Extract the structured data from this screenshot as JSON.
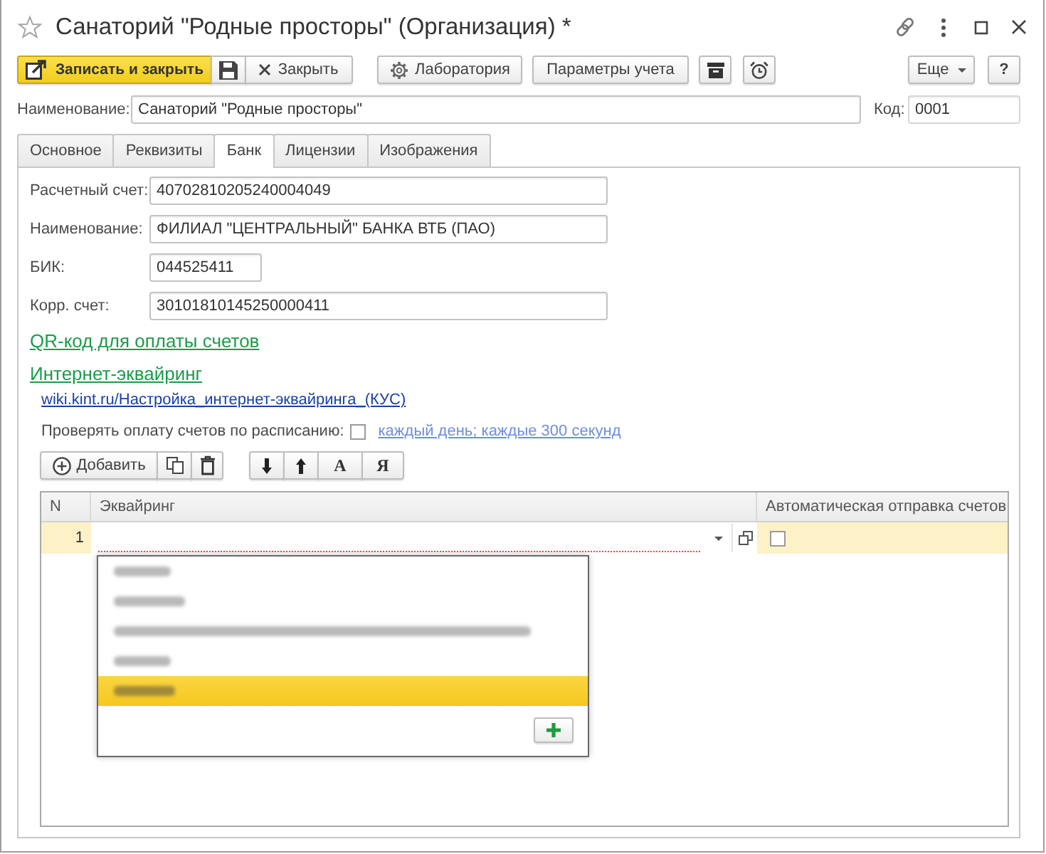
{
  "window": {
    "title": "Санаторий \"Родные просторы\" (Организация) *"
  },
  "toolbar": {
    "save_and_close": "Записать и закрыть",
    "close": "Закрыть",
    "laboratory": "Лаборатория",
    "accounting_parameters": "Параметры учета",
    "more": "Еще",
    "help": "?"
  },
  "header": {
    "name_label": "Наименование:",
    "name_value": "Санаторий \"Родные просторы\"",
    "code_label": "Код:",
    "code_value": "0001"
  },
  "tabs": [
    {
      "label": "Основное",
      "selected": false
    },
    {
      "label": "Реквизиты",
      "selected": false
    },
    {
      "label": "Банк",
      "selected": true
    },
    {
      "label": "Лицензии",
      "selected": false
    },
    {
      "label": "Изображения",
      "selected": false
    }
  ],
  "bank": {
    "fields": [
      {
        "label": "Расчетный счет:",
        "value": "40702810205240004049"
      },
      {
        "label": "Наименование:",
        "value": "ФИЛИАЛ \"ЦЕНТРАЛЬНЫЙ\" БАНКА ВТБ (ПАО)"
      },
      {
        "label": "БИК:",
        "value": "044525411"
      },
      {
        "label": "Корр. счет:",
        "value": "30101810145250000411"
      }
    ],
    "qr_link": "QR-код для оплаты счетов",
    "acquiring_link": "Интернет-эквайринг",
    "wiki_link": "wiki.kint.ru/Настройка_интернет-эквайринга_(КУС)",
    "schedule": {
      "label": "Проверять оплату счетов по расписанию:",
      "checked": false,
      "link": "каждый день; каждые 300 секунд"
    }
  },
  "table_toolbar": {
    "add": "Добавить",
    "sort_ascending": "А",
    "sort_descending": "Я"
  },
  "table": {
    "columns": [
      "N",
      "Эквайринг",
      "Автоматическая отправка счетов"
    ],
    "rows": [
      {
        "number": "1",
        "selected": true,
        "invalid": true,
        "auto_send": false
      }
    ]
  },
  "dropdown": {
    "items": [
      {
        "selected": false
      },
      {
        "selected": false
      },
      {
        "selected": false
      },
      {
        "selected": false
      },
      {
        "selected": true
      }
    ]
  }
}
